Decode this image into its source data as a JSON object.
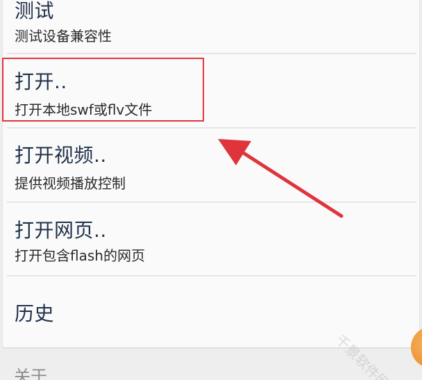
{
  "menu": {
    "items": [
      {
        "title": "测试",
        "subtitle": "测试设备兼容性"
      },
      {
        "title": "打开..",
        "subtitle": "打开本地swf或flv文件"
      },
      {
        "title": "打开视频..",
        "subtitle": "提供视频播放控制"
      },
      {
        "title": "打开网页..",
        "subtitle": "打开包含flash的网页"
      },
      {
        "title": "历史",
        "subtitle": ""
      }
    ]
  },
  "next_section": {
    "label": "关于"
  },
  "watermark": {
    "text": "千景软件网"
  },
  "colors": {
    "title_text": "#1f3149",
    "highlight": "#e0343c",
    "arrow": "#e0343c",
    "card_bg": "#fafafa",
    "page_bg": "#eeeeee"
  }
}
